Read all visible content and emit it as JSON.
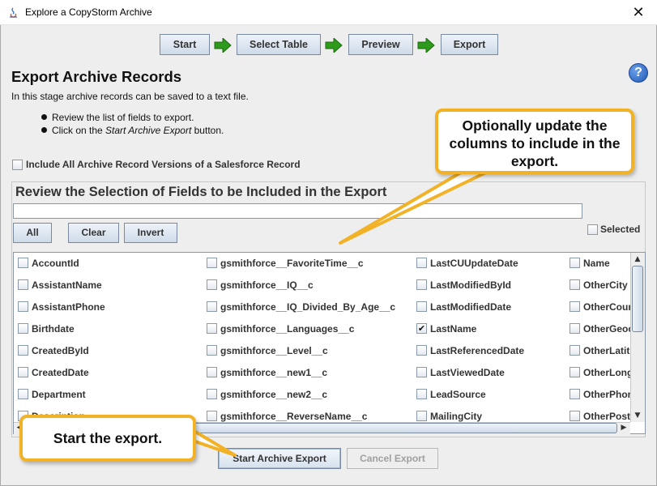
{
  "window": {
    "title": "Explore a CopyStorm Archive",
    "close_glyph": "✕"
  },
  "wizard": {
    "steps": [
      "Start",
      "Select Table",
      "Preview",
      "Export"
    ]
  },
  "help_glyph": "?",
  "heading": "Export Archive Records",
  "intro": "In this stage archive records can be saved to a text file.",
  "bullets": [
    "Review the list of fields to export.",
    "Click on the ",
    "Start Archive Export",
    " button."
  ],
  "include_all_versions": {
    "label": "Include All Archive Record Versions of a Salesforce Record",
    "checked": false
  },
  "review": {
    "title": "Review the Selection of Fields to be Included in the Export",
    "filter_value": "",
    "buttons": {
      "all": "All",
      "clear": "Clear",
      "invert": "Invert"
    },
    "selected_label": "Selected"
  },
  "fields": {
    "col1": [
      "AccountId",
      "AssistantName",
      "AssistantPhone",
      "Birthdate",
      "CreatedById",
      "CreatedDate",
      "Department",
      "Description"
    ],
    "col2": [
      "gsmithforce__FavoriteTime__c",
      "gsmithforce__IQ__c",
      "gsmithforce__IQ_Divided_By_Age__c",
      "gsmithforce__Languages__c",
      "gsmithforce__Level__c",
      "gsmithforce__new1__c",
      "gsmithforce__new2__c",
      "gsmithforce__ReverseName__c"
    ],
    "col3": [
      "LastCUUpdateDate",
      "LastModifiedById",
      "LastModifiedDate",
      "LastName",
      "LastReferencedDate",
      "LastViewedDate",
      "LeadSource",
      "MailingCity"
    ],
    "col4": [
      "Name",
      "OtherCity",
      "OtherCountry",
      "OtherGeocodeAccuracy",
      "OtherLatitude",
      "OtherLongitude",
      "OtherPhone",
      "OtherPostalCode"
    ],
    "checked": [
      "LastName"
    ]
  },
  "actions": {
    "start": "Start Archive Export",
    "cancel": "Cancel Export"
  },
  "callouts": {
    "update_columns": "Optionally update the columns to include in the export.",
    "start_export": "Start the export."
  },
  "colors": {
    "callout_border": "#f2b227",
    "arrow_green": "#2e9a1c",
    "help_blue": "#2159b6"
  }
}
